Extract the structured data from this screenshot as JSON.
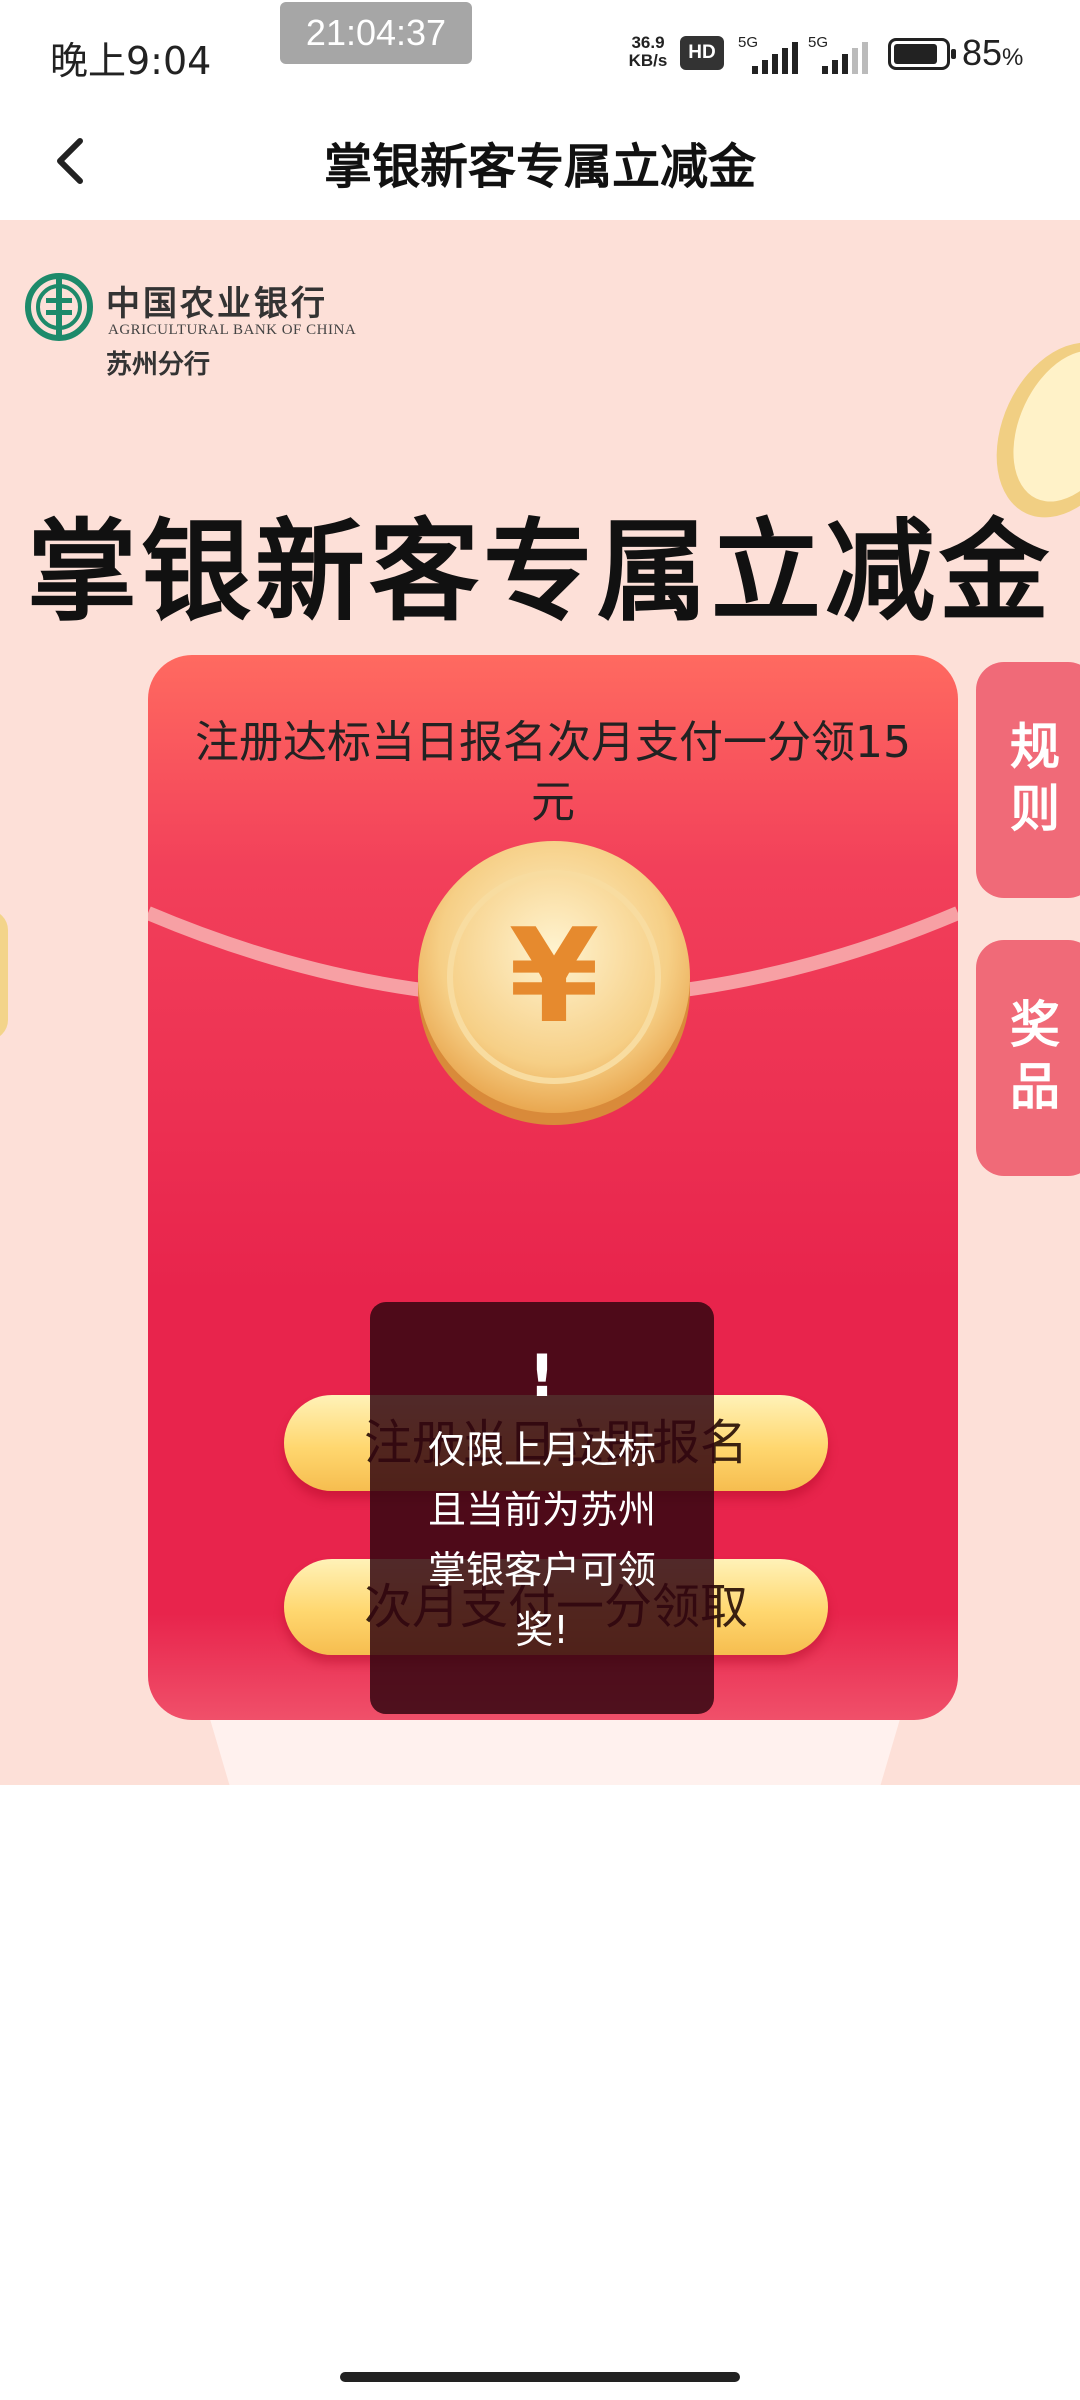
{
  "status_bar": {
    "time": "晚上9:04",
    "clock_badge": "21:04:37",
    "net_speed_value": "36.9",
    "net_speed_unit": "KB/s",
    "hd_label": "HD",
    "signal_1_label": "5G",
    "signal_2_label": "5G",
    "battery_percent": "85",
    "battery_unit": "%",
    "battery_level": 0.85
  },
  "title_bar": {
    "title": "掌银新客专属立减金",
    "back_icon": "chevron-left-icon"
  },
  "banner": {
    "bank_name_cn": "中国农业银行",
    "bank_name_en": "AGRICULTURAL BANK OF CHINA",
    "branch": "苏州分行",
    "hero_title": "掌银新客专属立减金",
    "side_tabs": [
      {
        "label": "规则"
      },
      {
        "label": "奖品"
      }
    ],
    "envelope": {
      "caption": "注册达标当日报名次月支付一分领15元",
      "coin_symbol": "¥",
      "button_1": "注册当日立即报名",
      "button_2": "次月支付一分领取"
    },
    "toast": {
      "mark": "!",
      "text": "仅限上月达标且当前为苏州掌银客户可领奖!"
    }
  },
  "colors": {
    "banner_bg": "#fde0d8",
    "envelope_red": "#e8244c",
    "side_tab": "#f06a78",
    "gold": "#ffd76f"
  }
}
